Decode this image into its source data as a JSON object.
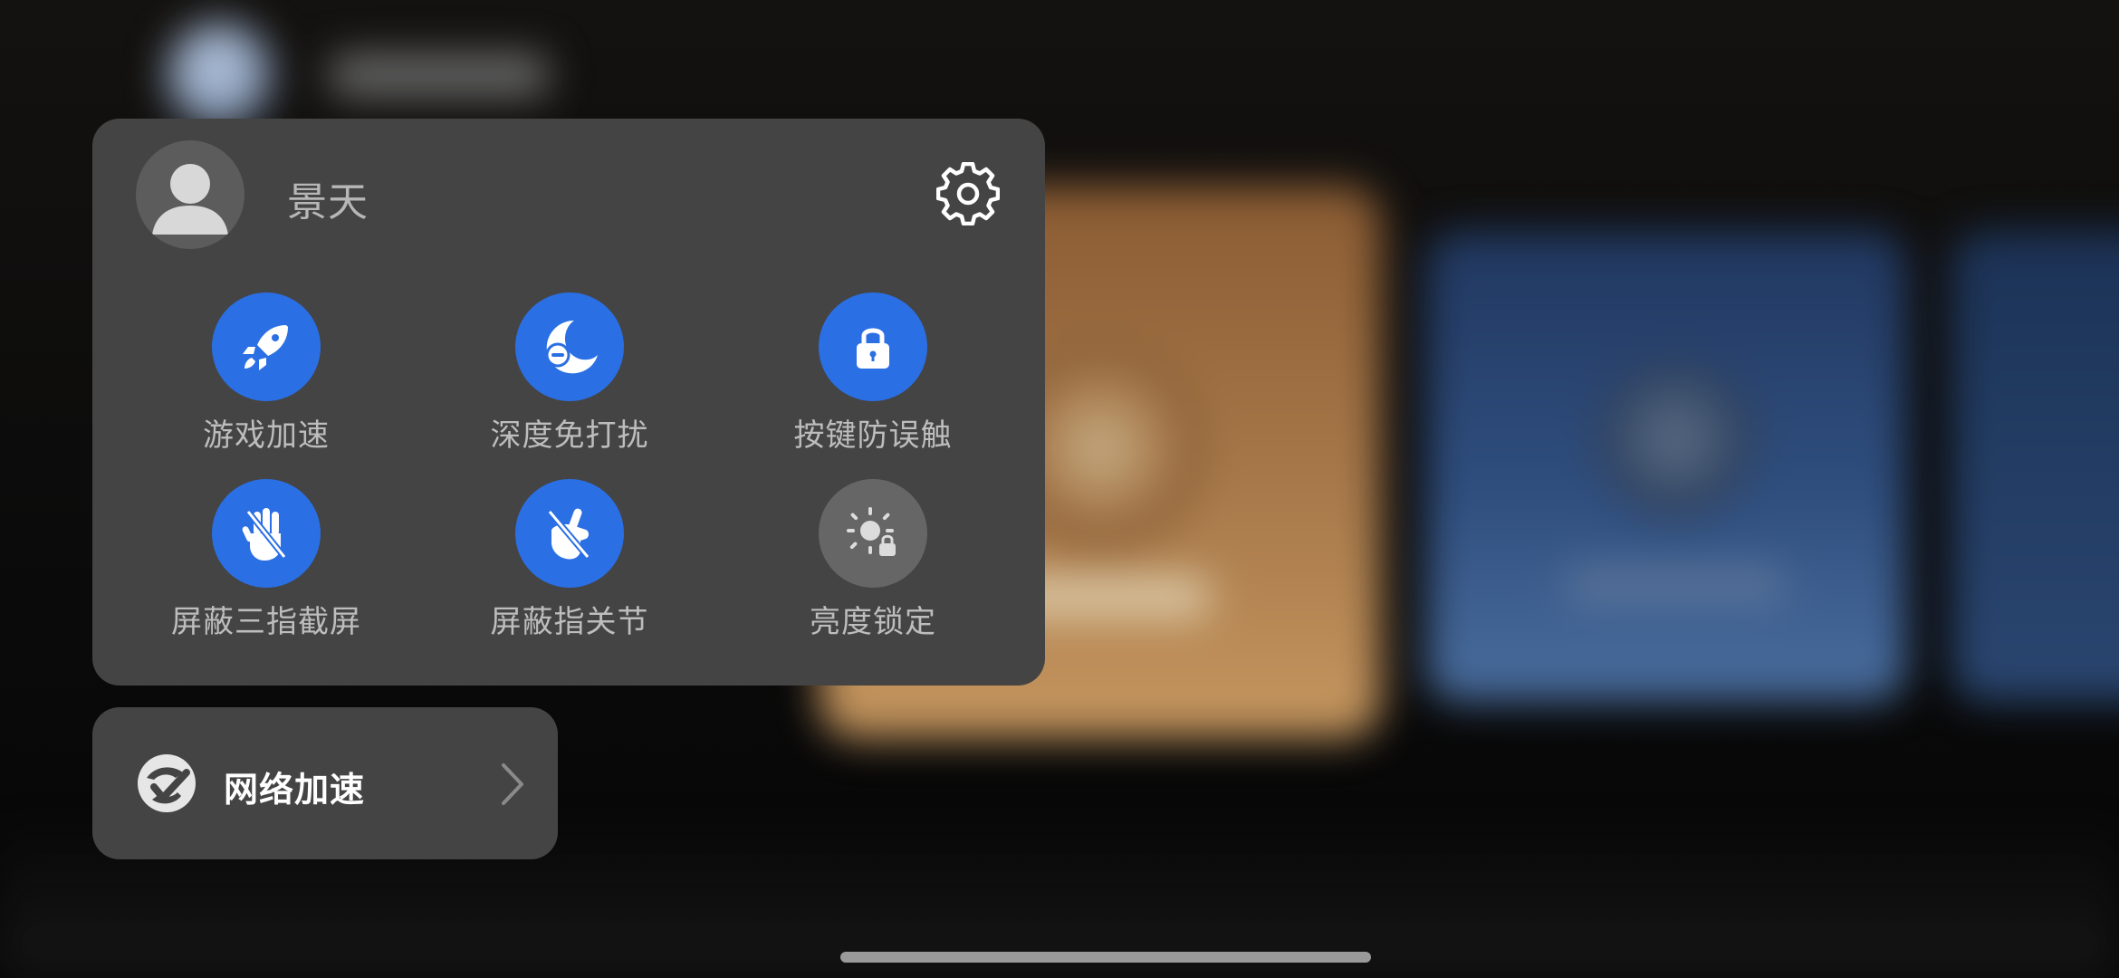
{
  "profile": {
    "name": "景天"
  },
  "features": [
    {
      "id": "game-boost",
      "label": "游戏加速",
      "icon": "rocket-icon",
      "state": "on"
    },
    {
      "id": "do-not-disturb",
      "label": "深度免打扰",
      "icon": "moon-minus-icon",
      "state": "on"
    },
    {
      "id": "button-lock",
      "label": "按键防误触",
      "icon": "lock-icon",
      "state": "on"
    },
    {
      "id": "block-three-finger-screenshot",
      "label": "屏蔽三指截屏",
      "icon": "three-finger-blocked-icon",
      "state": "on"
    },
    {
      "id": "block-knuckle",
      "label": "屏蔽指关节",
      "icon": "knuckle-blocked-icon",
      "state": "on"
    },
    {
      "id": "brightness-lock",
      "label": "亮度锁定",
      "icon": "sun-lock-icon",
      "state": "off"
    }
  ],
  "network": {
    "label": "网络加速",
    "icon": "network-boost-icon"
  },
  "colors": {
    "accent": "#2b6fe4",
    "panel": "#444444",
    "inactive": "#666666"
  }
}
